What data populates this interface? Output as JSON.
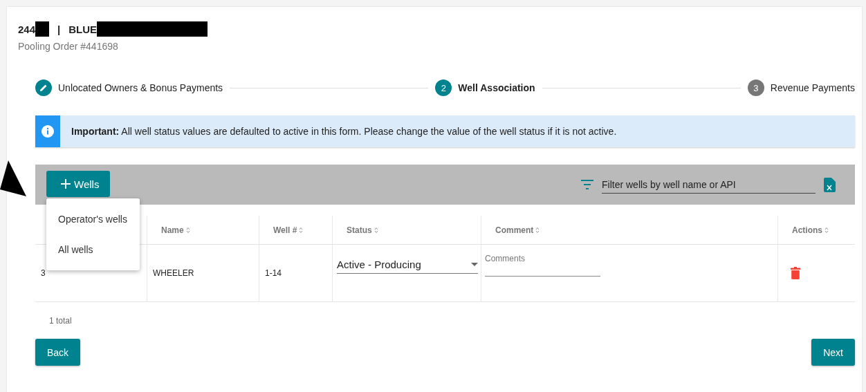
{
  "header": {
    "id_visible": "244",
    "separator": "|",
    "name_visible": "BLUE",
    "subtitle": "Pooling Order #441698"
  },
  "steps": [
    {
      "label": "Unlocated Owners & Bonus Payments",
      "kind": "done"
    },
    {
      "label": "Well Association",
      "number": "2",
      "kind": "active"
    },
    {
      "label": "Revenue Payments",
      "number": "3",
      "kind": "pending"
    }
  ],
  "alert": {
    "lead": "Important:",
    "text": "All well status values are defaulted to active in this form. Please change the value of the well status if it is not active."
  },
  "toolbar": {
    "add_button": "Wells",
    "filter_placeholder": "Filter wells by well name or API"
  },
  "menu": {
    "items": [
      "Operator's wells",
      "All wells"
    ]
  },
  "table": {
    "columns": [
      "Name",
      "Well #",
      "Status",
      "Comment",
      "Actions"
    ],
    "rows": [
      {
        "column_1": "3",
        "name": "WHEELER",
        "well_no": "1-14",
        "status": "Active - Producing",
        "comment_placeholder": "Comments"
      }
    ]
  },
  "total": "1 total",
  "buttons": {
    "back": "Back",
    "next": "Next"
  }
}
